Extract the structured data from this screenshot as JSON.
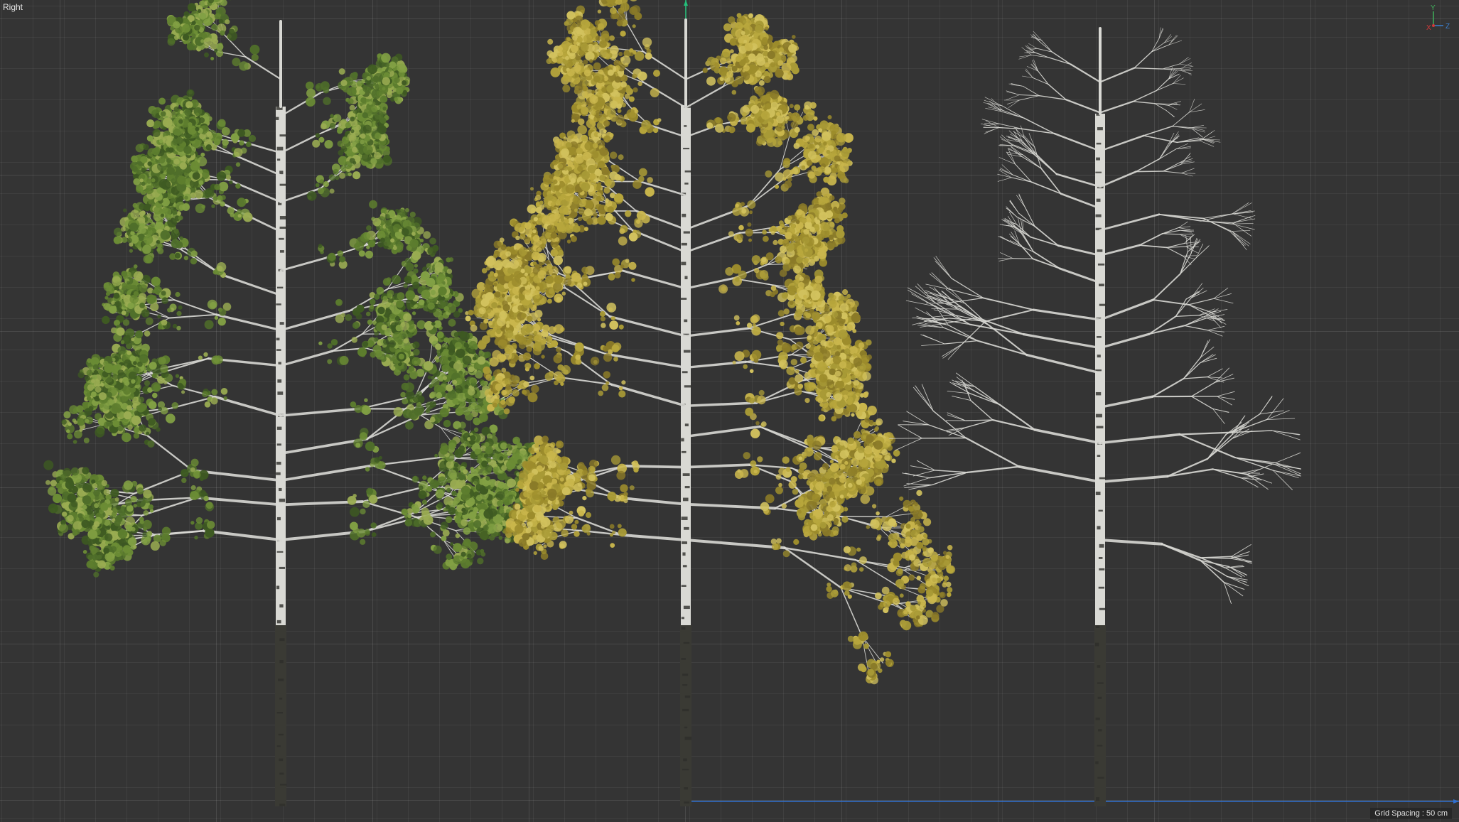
{
  "viewport": {
    "view_name": "Right",
    "grid_spacing_label": "Grid Spacing : 50 cm",
    "axis_gizmo": {
      "labels": [
        "Y",
        "X",
        "Z"
      ],
      "colors": {
        "y": "#3fae5a",
        "x": "#d03a3a",
        "z": "#3a7fd0"
      }
    }
  },
  "colors": {
    "background": "#343434",
    "y_axis_line": "#23c07a",
    "z_axis_line": "#3070d0",
    "trunk": "#d9d9d4",
    "trunk_dark": "#3a3a34",
    "summer_foliage": "#6c8a3a",
    "autumn_foliage": "#b8a43a",
    "bare_branches": "#c9c9c6"
  },
  "trees": [
    {
      "name": "summer-birch",
      "foliage": "summer"
    },
    {
      "name": "autumn-birch",
      "foliage": "autumn"
    },
    {
      "name": "bare-birch",
      "foliage": "none"
    }
  ]
}
